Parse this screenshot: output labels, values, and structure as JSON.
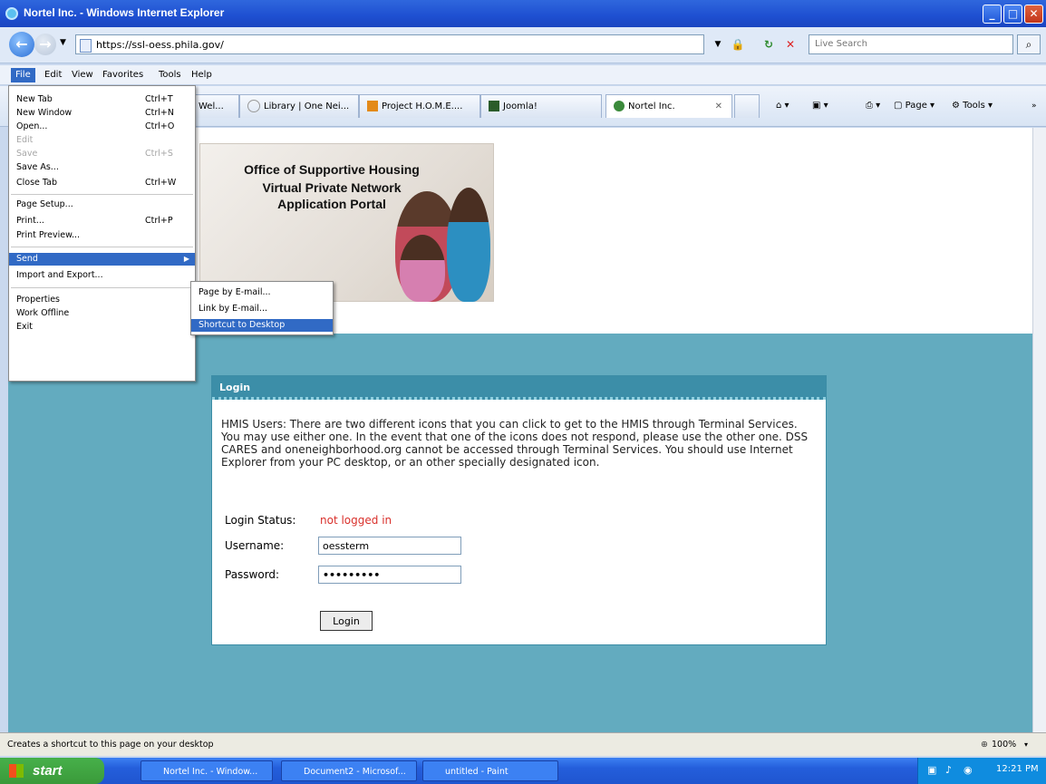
{
  "window": {
    "title": "Nortel Inc. - Windows Internet Explorer",
    "url": "https://ssl-oess.phila.gov/",
    "search_placeholder": "Live Search"
  },
  "menubar": [
    "File",
    "Edit",
    "View",
    "Favorites",
    "Tools",
    "Help"
  ],
  "tabs": [
    {
      "label": "Wel..."
    },
    {
      "label": "Library | One Nei..."
    },
    {
      "label": "Project H.O.M.E...."
    },
    {
      "label": "Joomla!"
    },
    {
      "label": "Nortel Inc."
    }
  ],
  "commandbar": {
    "page": "Page",
    "tools": "Tools"
  },
  "file_menu": {
    "items": [
      {
        "label": "New Tab",
        "shortcut": "Ctrl+T"
      },
      {
        "label": "New Window",
        "shortcut": "Ctrl+N"
      },
      {
        "label": "Open...",
        "shortcut": "Ctrl+O"
      },
      {
        "label": "Edit",
        "shortcut": ""
      },
      {
        "label": "Save",
        "shortcut": "Ctrl+S"
      },
      {
        "label": "Save As...",
        "shortcut": ""
      },
      {
        "label": "Close Tab",
        "shortcut": "Ctrl+W"
      },
      {
        "label": "Page Setup...",
        "shortcut": ""
      },
      {
        "label": "Print...",
        "shortcut": "Ctrl+P"
      },
      {
        "label": "Print Preview...",
        "shortcut": ""
      },
      {
        "label": "Send",
        "shortcut": ""
      },
      {
        "label": "Import and Export...",
        "shortcut": ""
      },
      {
        "label": "Properties",
        "shortcut": ""
      },
      {
        "label": "Work Offline",
        "shortcut": ""
      },
      {
        "label": "Exit",
        "shortcut": ""
      }
    ]
  },
  "send_menu": {
    "items": [
      "Page by E-mail...",
      "Link by E-mail...",
      "Shortcut to Desktop"
    ]
  },
  "banner": {
    "line1": "Office of Supportive Housing",
    "line2": "Virtual Private Network",
    "line3": "Application Portal"
  },
  "login": {
    "header": "Login",
    "message": "HMIS Users: There are two different icons that you can click to get to the HMIS through Terminal Services. You may use either one. In the event that one of the icons does not respond, please use the other one. DSS CARES and oneneighborhood.org cannot be accessed through Terminal Services. You should use Internet Explorer from your PC desktop, or an other specially designated icon.",
    "status_label": "Login Status:",
    "status_value": "not logged in",
    "username_label": "Username:",
    "username_value": "oessterm",
    "password_label": "Password:",
    "password_value": "•••••••••",
    "button": "Login"
  },
  "statusbar": {
    "text": "Creates a shortcut to this page on your desktop",
    "zoom": "100%"
  },
  "taskbar": {
    "start": "start",
    "tasks": [
      "Nortel Inc. - Window...",
      "Document2 - Microsof...",
      "untitled - Paint"
    ],
    "clock": "12:21 PM"
  },
  "colors": {
    "accent": "#316ac5",
    "teal_bg": "#63abbf",
    "login_header": "#3c8ea8",
    "status_error": "#d9302b"
  }
}
